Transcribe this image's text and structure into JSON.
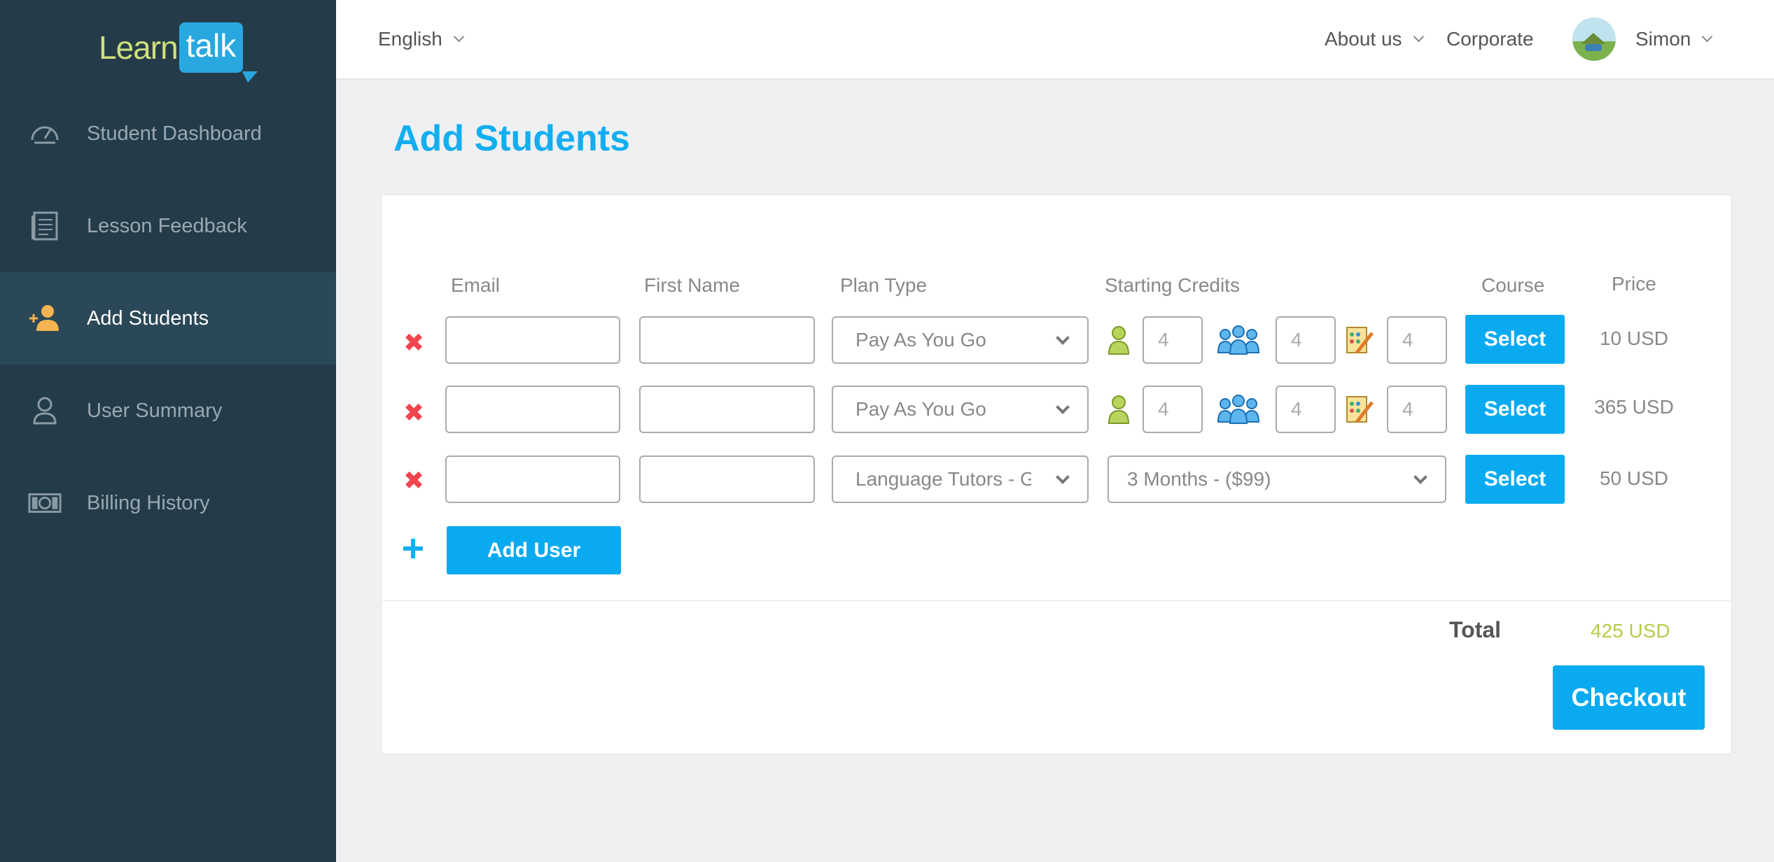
{
  "brand": {
    "logo_part1": "Learn",
    "logo_part2": "talk"
  },
  "sidebar": {
    "items": [
      {
        "label": "Student Dashboard",
        "icon": "speedometer-icon",
        "active": false
      },
      {
        "label": "Lesson Feedback",
        "icon": "document-list-icon",
        "active": false
      },
      {
        "label": "Add Students",
        "icon": "add-user-icon",
        "active": true
      },
      {
        "label": "User Summary",
        "icon": "user-outline-icon",
        "active": false
      },
      {
        "label": "Billing History",
        "icon": "money-bill-icon",
        "active": false
      }
    ]
  },
  "header": {
    "language": "English",
    "about": "About us",
    "corporate": "Corporate",
    "user_name": "Simon"
  },
  "page": {
    "title": "Add Students"
  },
  "table": {
    "columns": {
      "email": "Email",
      "first_name": "First Name",
      "plan_type": "Plan Type",
      "starting_credits": "Starting Credits",
      "course": "Course",
      "price": "Price"
    },
    "rows": [
      {
        "email": "",
        "first_name": "",
        "plan": "Pay As You Go",
        "credits": [
          "4",
          "4",
          "4"
        ],
        "course_button": "Select",
        "price": "10 USD"
      },
      {
        "email": "",
        "first_name": "",
        "plan": "Pay As You Go",
        "credits": [
          "4",
          "4",
          "4"
        ],
        "course_button": "Select",
        "price": "365 USD"
      },
      {
        "email": "",
        "first_name": "",
        "plan": "Language Tutors - Gr",
        "package": "3 Months - ($99)",
        "course_button": "Select",
        "price": "50 USD"
      }
    ],
    "add_user_label": "Add User"
  },
  "summary": {
    "total_label": "Total",
    "total_value": "425 USD",
    "checkout_label": "Checkout"
  },
  "colors": {
    "accent": "#0aaaf0",
    "sidebar_bg": "#243c4a",
    "remove": "#f0454f",
    "total": "#b5cc4a"
  }
}
